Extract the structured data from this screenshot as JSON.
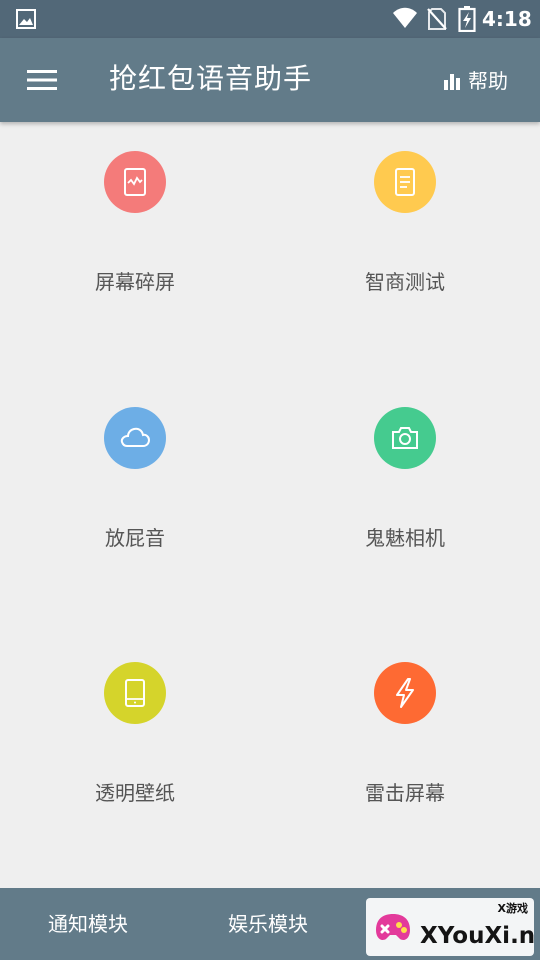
{
  "status_bar": {
    "time": "4:18",
    "icons": [
      "image-notification-icon",
      "wifi-icon",
      "no-sim-icon",
      "battery-charging-icon"
    ]
  },
  "toolbar": {
    "title": "抢红包语音助手",
    "help_label": "帮助",
    "icons": [
      "menu-icon",
      "bar-chart-icon"
    ]
  },
  "features": [
    {
      "label": "屏幕碎屏",
      "icon": "cracked-screen-icon",
      "color": "#f47b7a"
    },
    {
      "label": "智商测试",
      "icon": "document-icon",
      "color": "#ffca4f"
    },
    {
      "label": "放屁音",
      "icon": "cloud-icon",
      "color": "#6daee6"
    },
    {
      "label": "鬼魅相机",
      "icon": "camera-icon",
      "color": "#45cb8f"
    },
    {
      "label": "透明壁纸",
      "icon": "tablet-icon",
      "color": "#d5d42b"
    },
    {
      "label": "雷击屏幕",
      "icon": "lightning-icon",
      "color": "#fe6a33"
    }
  ],
  "bottom_nav": {
    "tabs": [
      "通知模块",
      "娱乐模块"
    ]
  },
  "watermark": {
    "top_text": "X游戏",
    "main_text": "XYouXi.net"
  },
  "colors": {
    "status_bar": "#526878",
    "toolbar": "#627b89",
    "background": "#efefef",
    "label_text": "#555555"
  }
}
